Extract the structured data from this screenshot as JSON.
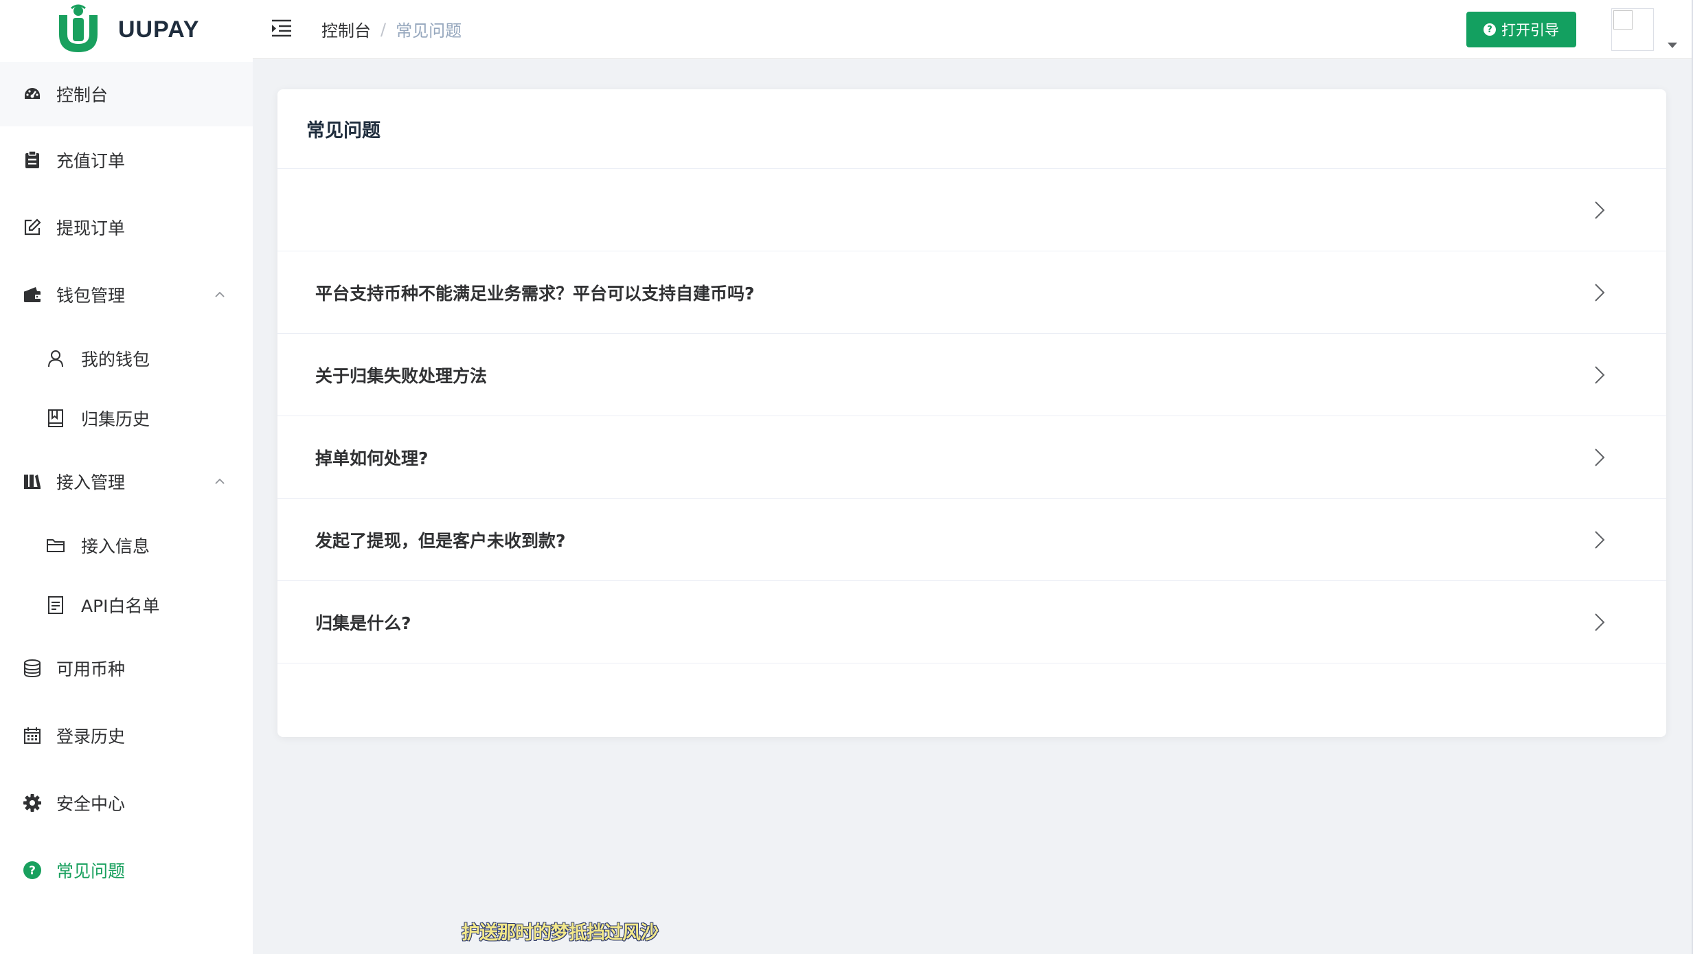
{
  "brand": {
    "name": "UUPAY",
    "color": "#19a05e"
  },
  "sidebar": {
    "items": [
      {
        "label": "控制台",
        "icon": "dashboard-icon"
      },
      {
        "label": "充值订单",
        "icon": "clipboard-icon"
      },
      {
        "label": "提现订单",
        "icon": "edit-icon"
      },
      {
        "label": "钱包管理",
        "icon": "wallet-icon",
        "expanded": true
      },
      {
        "label": "我的钱包",
        "icon": "user-icon"
      },
      {
        "label": "归集历史",
        "icon": "book-icon"
      },
      {
        "label": "接入管理",
        "icon": "library-icon",
        "expanded": true
      },
      {
        "label": "接入信息",
        "icon": "folder-icon"
      },
      {
        "label": "API白名单",
        "icon": "document-icon"
      },
      {
        "label": "可用币种",
        "icon": "database-icon"
      },
      {
        "label": "登录历史",
        "icon": "calendar-icon"
      },
      {
        "label": "安全中心",
        "icon": "gear-icon"
      },
      {
        "label": "常见问题",
        "icon": "question-circle-icon",
        "active": true
      }
    ]
  },
  "header": {
    "breadcrumb": {
      "home": "控制台",
      "separator": "/",
      "current": "常见问题"
    },
    "guide_button": "打开引导",
    "guide_color": "#13a060"
  },
  "main": {
    "card_title": "常见问题",
    "faq": [
      "",
      "平台支持币种不能满足业务需求？平台可以支持自建币吗?",
      "关于归集失败处理方法",
      "掉单如何处理?",
      "发起了提现，但是客户未收到款?",
      "归集是什么?"
    ]
  },
  "overlay_subtitle": "护送那时的梦抵挡过风沙"
}
